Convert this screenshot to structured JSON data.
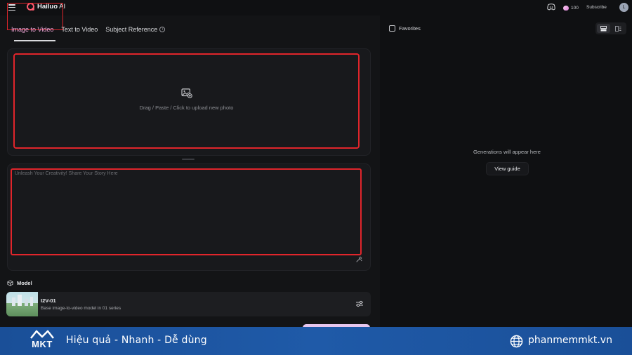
{
  "app": {
    "name_bold": "Hailuo",
    "name_rest": " AI"
  },
  "header": {
    "credits": "100",
    "subscribe_label": "Subscribe",
    "avatar_initial": "L"
  },
  "tabs": [
    {
      "label": "Image to Video",
      "active": true
    },
    {
      "label": "Text to Video",
      "active": false
    },
    {
      "label": "Subject Reference",
      "active": false
    }
  ],
  "upload": {
    "hint": "Drag / Paste / Click to upload new photo"
  },
  "prompt": {
    "placeholder": "Unleash Your Creativity! Share Your Story Here",
    "value": ""
  },
  "model": {
    "section_label": "Model",
    "name": "I2V-01",
    "description": "Base image-to-video model in 01 series"
  },
  "right_panel": {
    "favorites_label": "Favorites",
    "favorites_checked": false,
    "empty_message": "Generations will appear here",
    "guide_button": "View guide"
  },
  "banner": {
    "logo_text": "MKT",
    "slogan": "Hiệu quả - Nhanh - Dễ dùng",
    "website": "phanmemmkt.vn"
  },
  "colors": {
    "accent_pink": "#f2a8dc",
    "highlight_red": "#e0252b",
    "banner_blue": "#1f5aa8",
    "background": "#0f1012"
  },
  "icons": [
    "menu-icon",
    "logo-icon",
    "discord-icon",
    "gem-icon",
    "info-icon",
    "image-add-icon",
    "wand-icon",
    "cube-icon",
    "settings-icon",
    "list-view-icon",
    "grid-view-icon",
    "globe-icon"
  ]
}
